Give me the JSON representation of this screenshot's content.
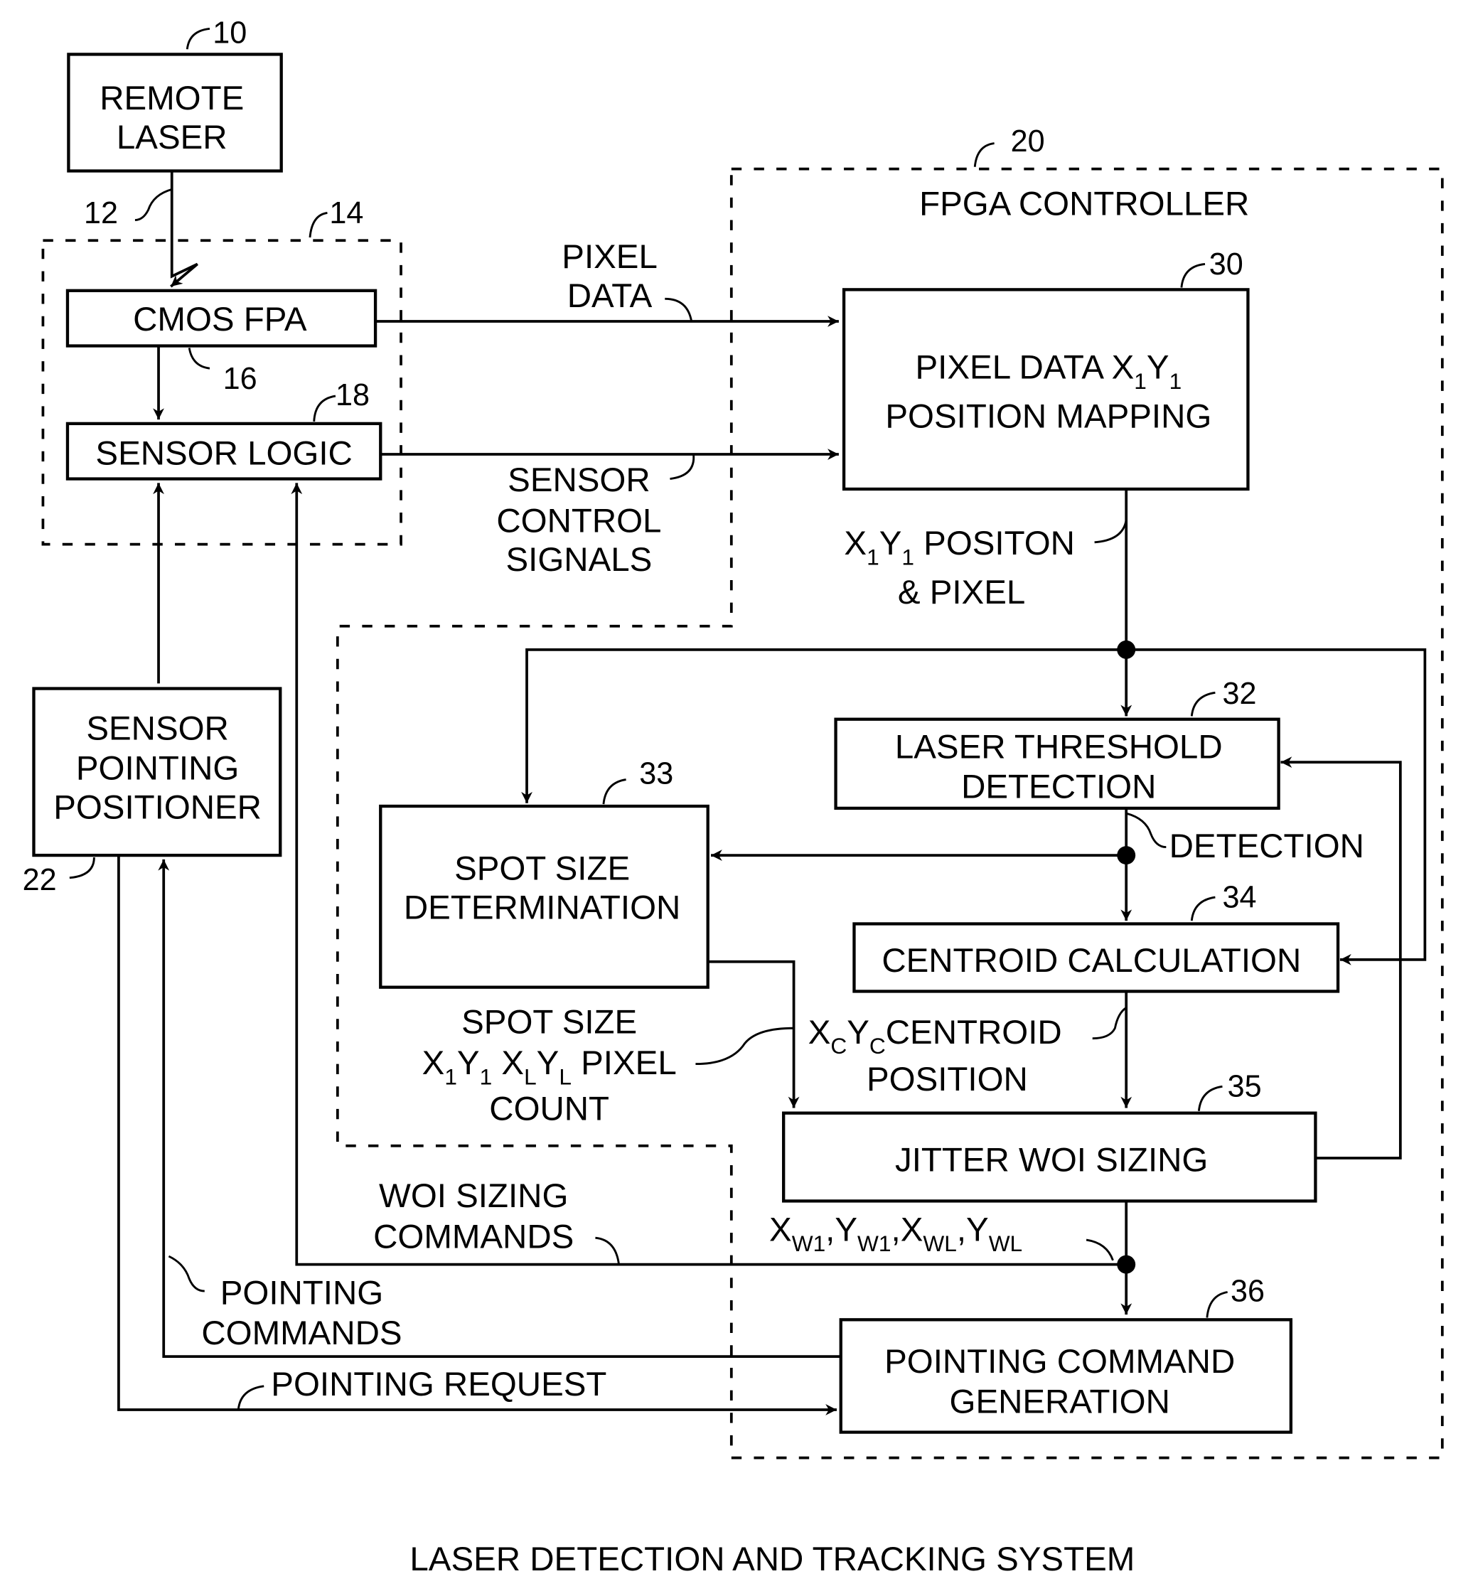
{
  "title": "LASER DETECTION AND TRACKING SYSTEM",
  "blocks": {
    "remote_laser": {
      "ref": "10",
      "lines": [
        "REMOTE",
        "LASER"
      ]
    },
    "cmos_fpa": {
      "ref": "16",
      "lines": [
        "CMOS FPA"
      ]
    },
    "sensor_logic": {
      "ref": "18",
      "lines": [
        "SENSOR LOGIC"
      ]
    },
    "sensor_module": {
      "ref": "14"
    },
    "sensor_pointing_positioner": {
      "ref": "22",
      "lines": [
        "SENSOR",
        "POINTING",
        "POSITIONER"
      ]
    },
    "fpga_controller": {
      "ref": "20",
      "label": "FPGA CONTROLLER"
    },
    "position_mapping": {
      "ref": "30",
      "line1": "PIXEL DATA X",
      "sub1": "1",
      "mid": "Y",
      "sub2": "1",
      "line2": "POSITION MAPPING"
    },
    "laser_threshold": {
      "ref": "32",
      "lines": [
        "LASER THRESHOLD",
        "DETECTION"
      ]
    },
    "spot_size": {
      "ref": "33",
      "lines": [
        "SPOT SIZE",
        "DETERMINATION"
      ]
    },
    "centroid": {
      "ref": "34",
      "lines": [
        "CENTROID CALCULATION"
      ]
    },
    "jitter_woi": {
      "ref": "35",
      "lines": [
        "JITTER WOI SIZING"
      ]
    },
    "pointing_command": {
      "ref": "36",
      "lines": [
        "POINTING COMMAND",
        "GENERATION"
      ]
    }
  },
  "signals": {
    "laser_beam": {
      "ref": "12"
    },
    "pixel_data": [
      "PIXEL",
      "DATA"
    ],
    "sensor_control": [
      "SENSOR",
      "CONTROL",
      "SIGNALS"
    ],
    "xy_position": {
      "x": "X",
      "s1": "1",
      "y": "Y",
      "s2": "1",
      "rest": " POSITON",
      "line2": "& PIXEL"
    },
    "detection": "DETECTION",
    "spot_size_out": {
      "line1": "SPOT SIZE",
      "line2_parts": [
        "X",
        "1",
        "Y",
        "1",
        " X",
        "L",
        "Y",
        "L",
        " PIXEL"
      ],
      "line3": "COUNT"
    },
    "centroid_out": {
      "x": "X",
      "xs": "C",
      "y": "Y",
      "ys": "C",
      "rest": "CENTROID",
      "line2": "POSITION"
    },
    "woi_out": {
      "parts": [
        "X",
        "W1",
        ",Y",
        "W1",
        ",X",
        "WL",
        ",Y",
        "WL"
      ]
    },
    "woi_sizing_commands": [
      "WOI SIZING",
      "COMMANDS"
    ],
    "pointing_commands": [
      "POINTING",
      "COMMANDS"
    ],
    "pointing_request": "POINTING REQUEST"
  }
}
